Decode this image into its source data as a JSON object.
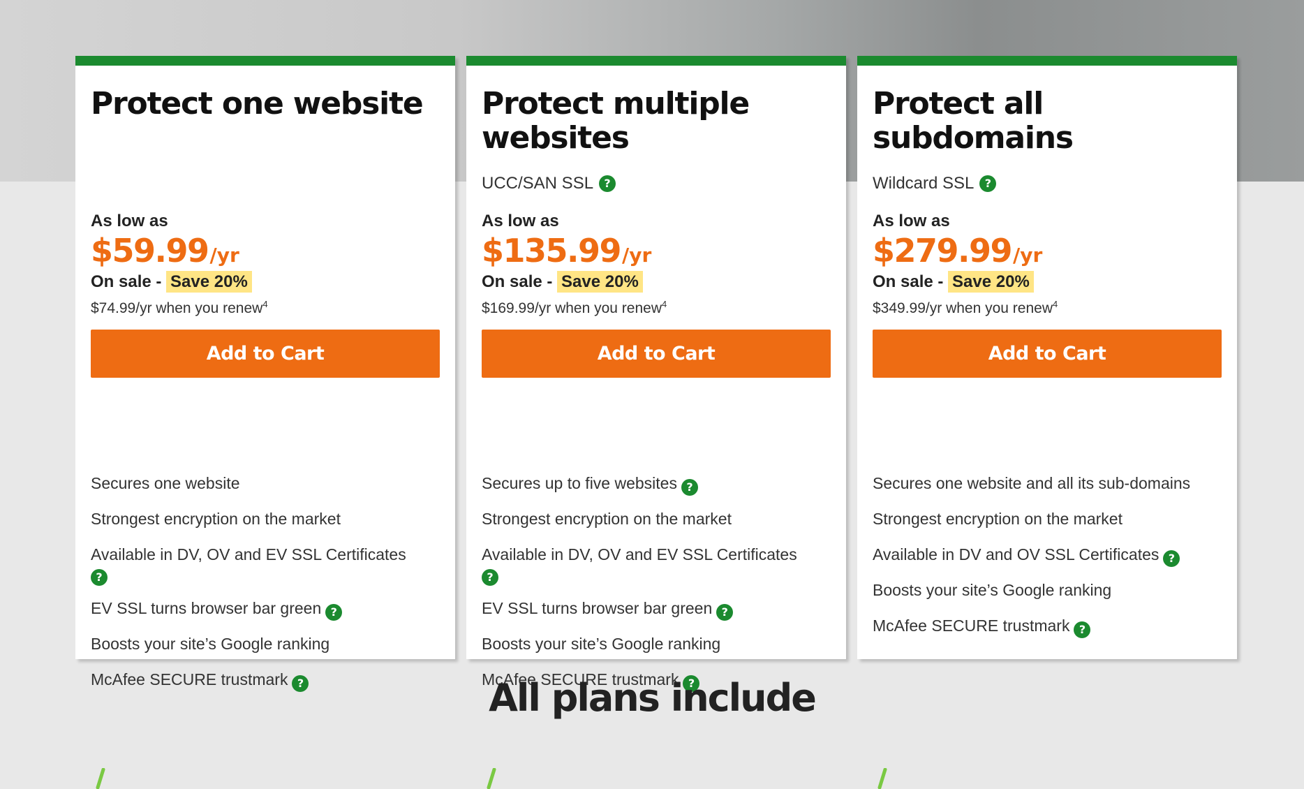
{
  "colors": {
    "accent_green": "#1b8a2f",
    "price_orange": "#ee6c13",
    "save_highlight": "#ffe585",
    "check_green": "#7ac943"
  },
  "plans": [
    {
      "title": "Protect one website",
      "subtitle": "",
      "as_low_as": "As low as",
      "price": "$59.99",
      "per": "/yr",
      "sale_prefix": "On sale - ",
      "save": "Save 20%",
      "renew": "$74.99/yr when you renew",
      "footnote": "4",
      "button": "Add to Cart",
      "features": [
        {
          "text": "Secures one website",
          "help": false
        },
        {
          "text": "Strongest encryption on the market",
          "help": false
        },
        {
          "text": "Available in DV, OV and EV SSL Certificates",
          "help": true
        },
        {
          "text": "EV SSL turns browser bar green",
          "help": true
        },
        {
          "text": "Boosts your site’s Google ranking",
          "help": false
        },
        {
          "text": "McAfee SECURE trustmark",
          "help": true
        }
      ]
    },
    {
      "title": "Protect multiple websites",
      "subtitle": "UCC/SAN SSL",
      "as_low_as": "As low as",
      "price": "$135.99",
      "per": "/yr",
      "sale_prefix": "On sale - ",
      "save": "Save 20%",
      "renew": "$169.99/yr when you renew",
      "footnote": "4",
      "button": "Add to Cart",
      "features": [
        {
          "text": "Secures up to five websites",
          "help": true
        },
        {
          "text": "Strongest encryption on the market",
          "help": false
        },
        {
          "text": "Available in DV, OV and EV SSL Certificates",
          "help": true
        },
        {
          "text": "EV SSL turns browser bar green",
          "help": true
        },
        {
          "text": "Boosts your site’s Google ranking",
          "help": false
        },
        {
          "text": "McAfee SECURE trustmark",
          "help": true
        }
      ]
    },
    {
      "title": "Protect all subdomains",
      "subtitle": "Wildcard SSL",
      "as_low_as": "As low as",
      "price": "$279.99",
      "per": "/yr",
      "sale_prefix": "On sale - ",
      "save": "Save 20%",
      "renew": "$349.99/yr when you renew",
      "footnote": "4",
      "button": "Add to Cart",
      "features": [
        {
          "text": "Secures one website and all its sub-domains",
          "help": false
        },
        {
          "text": "Strongest encryption on the market",
          "help": false
        },
        {
          "text": "Available in DV and OV SSL Certificates",
          "help": true
        },
        {
          "text": "Boosts your site’s Google ranking",
          "help": false
        },
        {
          "text": "McAfee SECURE trustmark",
          "help": true
        }
      ]
    }
  ],
  "help_glyph": "?",
  "section_heading": "All plans include"
}
